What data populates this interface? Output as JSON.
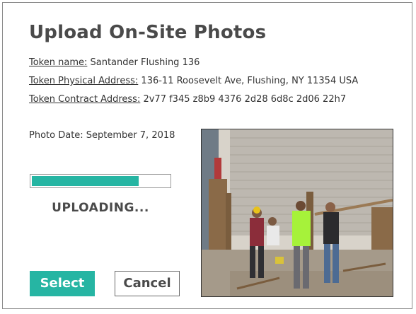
{
  "dialog": {
    "title": "Upload On-Site Photos"
  },
  "token": {
    "name_label": "Token name:",
    "name_value": " Santander Flushing 136",
    "physical_label": "Token Physical Address:",
    "physical_value": " 136-11 Roosevelt Ave, Flushing, NY 11354 USA",
    "contract_label": "Token Contract Address:",
    "contract_value": " 2v77 f345 z8b9 4376 2d28 6d8c 2d06 22h7"
  },
  "photo": {
    "date_text": "Photo Date: September 7, 2018",
    "description": "construction site photo"
  },
  "upload": {
    "progress_percent": 78,
    "status_text": "UPLOADING...",
    "accent_color": "#26b5a3"
  },
  "buttons": {
    "select_label": "Select",
    "cancel_label": "Cancel"
  }
}
